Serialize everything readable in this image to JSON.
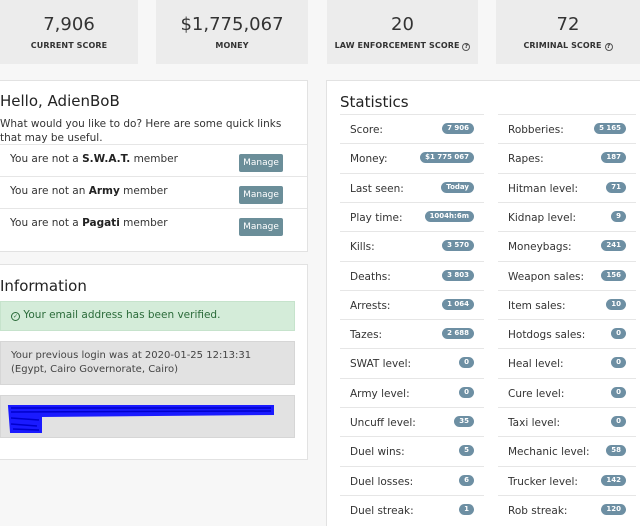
{
  "top_stats": [
    {
      "value": "7,906",
      "label": "CURRENT SCORE",
      "help": false
    },
    {
      "value": "$1,775,067",
      "label": "MONEY",
      "help": false
    },
    {
      "value": "20",
      "label": "LAW ENFORCEMENT SCORE",
      "help": true
    },
    {
      "value": "72",
      "label": "CRIMINAL SCORE",
      "help": true
    }
  ],
  "hello": {
    "title": "Hello, AdienBoB",
    "intro": "What would you like to do? Here are some quick links that may be useful.",
    "rows": [
      {
        "prefix": "You are not a",
        "group": "S.W.A.T.",
        "suffix": "member",
        "button": "Manage"
      },
      {
        "prefix": "You are not an",
        "group": "Army",
        "suffix": "member",
        "button": "Manage"
      },
      {
        "prefix": "You are not a",
        "group": "Pagati",
        "suffix": "member",
        "button": "Manage"
      }
    ]
  },
  "information": {
    "title": "Information",
    "verified": "Your email address has been verified.",
    "last_login": "Your previous login was at 2020-01-25 12:13:31 (Egypt, Cairo Governorate, Cairo)",
    "scribble_color": "#1a1aff"
  },
  "statistics": {
    "title": "Statistics",
    "left": [
      {
        "label": "Score:",
        "value": "7 906"
      },
      {
        "label": "Money:",
        "value": "$1 775 067"
      },
      {
        "label": "Last seen:",
        "value": "Today"
      },
      {
        "label": "Play time:",
        "value": "1004h:6m"
      },
      {
        "label": "Kills:",
        "value": "3 570"
      },
      {
        "label": "Deaths:",
        "value": "3 803"
      },
      {
        "label": "Arrests:",
        "value": "1 064"
      },
      {
        "label": "Tazes:",
        "value": "2 688"
      },
      {
        "label": "SWAT level:",
        "value": "0"
      },
      {
        "label": "Army level:",
        "value": "0"
      },
      {
        "label": "Uncuff level:",
        "value": "35"
      },
      {
        "label": "Duel wins:",
        "value": "5"
      },
      {
        "label": "Duel losses:",
        "value": "6"
      },
      {
        "label": "Duel streak:",
        "value": "1"
      }
    ],
    "right": [
      {
        "label": "Robberies:",
        "value": "5 165"
      },
      {
        "label": "Rapes:",
        "value": "187"
      },
      {
        "label": "Hitman level:",
        "value": "71"
      },
      {
        "label": "Kidnap level:",
        "value": "9"
      },
      {
        "label": "Moneybags:",
        "value": "241"
      },
      {
        "label": "Weapon sales:",
        "value": "156"
      },
      {
        "label": "Item sales:",
        "value": "10"
      },
      {
        "label": "Hotdogs sales:",
        "value": "0"
      },
      {
        "label": "Heal level:",
        "value": "0"
      },
      {
        "label": "Cure level:",
        "value": "0"
      },
      {
        "label": "Taxi level:",
        "value": "0"
      },
      {
        "label": "Mechanic level:",
        "value": "58"
      },
      {
        "label": "Trucker level:",
        "value": "142"
      },
      {
        "label": "Rob streak:",
        "value": "120"
      }
    ]
  }
}
